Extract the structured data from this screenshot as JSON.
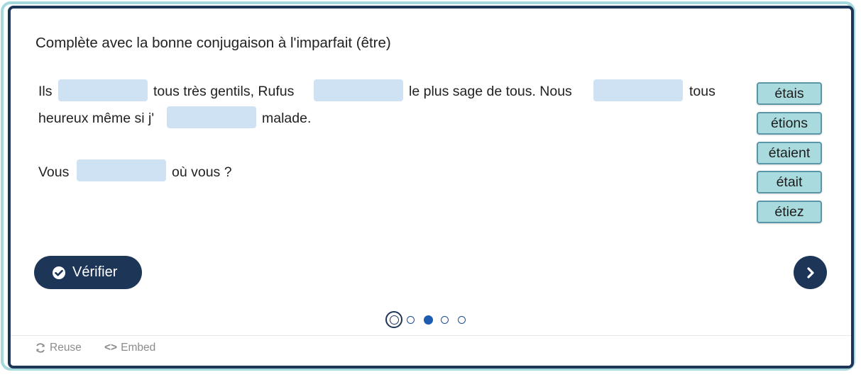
{
  "question": "Complète avec la bonne conjugaison à l'imparfait (être)",
  "sentences": {
    "line1": {
      "w1": "Ils",
      "w2": "tous très gentils, Rufus",
      "w3": "le plus sage de tous. Nous",
      "w4": "tous"
    },
    "line2": {
      "w1": "heureux même si j'",
      "w2": "malade."
    },
    "line3": {
      "w1": "Vous",
      "w2": "où vous ?"
    }
  },
  "word_bank": [
    "étais",
    "étions",
    "étaient",
    "était",
    "étiez"
  ],
  "check_button": {
    "label": "Vérifier",
    "icon": "check-circle-icon"
  },
  "next_button": {
    "icon": "chevron-right-icon"
  },
  "pagination": {
    "total": 5,
    "current": 1,
    "answered": 3
  },
  "footer": {
    "reuse_label": "Reuse",
    "embed_label": "Embed"
  },
  "colors": {
    "primary": "#1d3557",
    "accent_border": "#a4d8dc",
    "blank": "#cfe2f4",
    "word_bg": "#a9dbde"
  }
}
